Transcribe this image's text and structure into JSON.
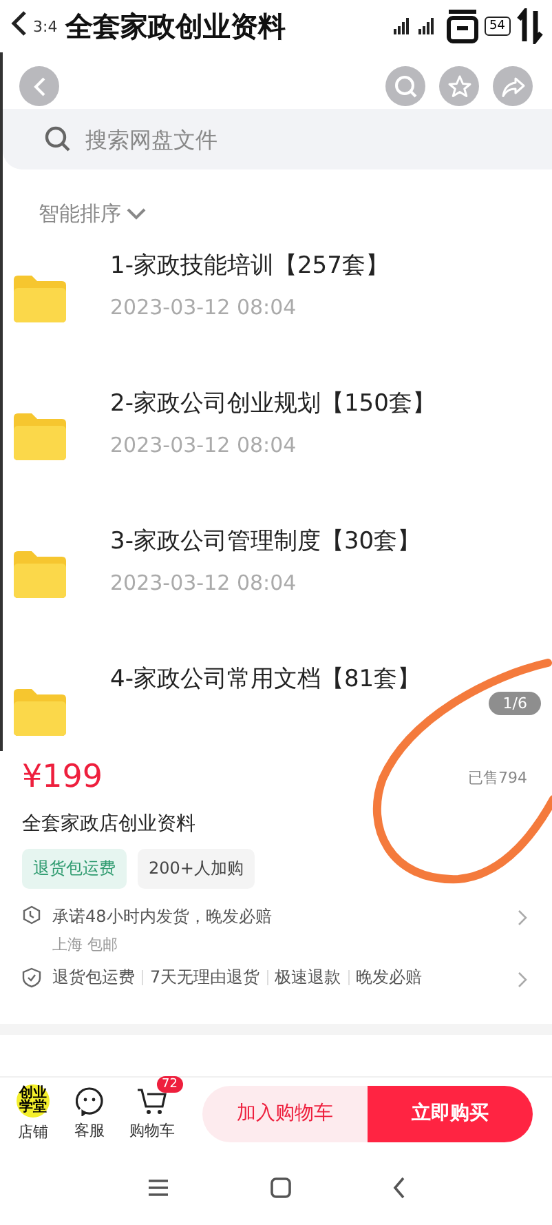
{
  "status_bar": {
    "time": "3:4",
    "battery": "54"
  },
  "header": {
    "title": "全套家政创业资料"
  },
  "gallery": {
    "search": {
      "placeholder": "搜索网盘文件"
    },
    "sort": "智能排序",
    "folders": [
      {
        "name": "1-家政技能培训【257套】",
        "date": "2023-03-12  08:04"
      },
      {
        "name": "2-家政公司创业规划【150套】",
        "date": "2023-03-12  08:04"
      },
      {
        "name": "3-家政公司管理制度【30套】",
        "date": "2023-03-12  08:04"
      },
      {
        "name": "4-家政公司常用文档【81套】"
      }
    ],
    "counter": "1/6"
  },
  "product": {
    "price": "¥199",
    "sold": "已售794",
    "title": "全套家政店创业资料",
    "tags": [
      {
        "label": "退货包运费",
        "kind": "green"
      },
      {
        "label": "200+人加购",
        "kind": "grey"
      }
    ],
    "shipping": {
      "text": "承诺48小时内发货，晚发必赔",
      "sub": "上海 包邮"
    },
    "guarantees": [
      "退货包运费",
      "7天无理由退货",
      "极速退款",
      "晚发必赔"
    ]
  },
  "bottom_bar": {
    "shop": {
      "logo": [
        "创业",
        "学堂"
      ],
      "label": "店铺"
    },
    "service": "客服",
    "cart": {
      "label": "购物车",
      "badge": "72"
    },
    "add_to_cart": "加入购物车",
    "buy_now": "立即购买"
  }
}
